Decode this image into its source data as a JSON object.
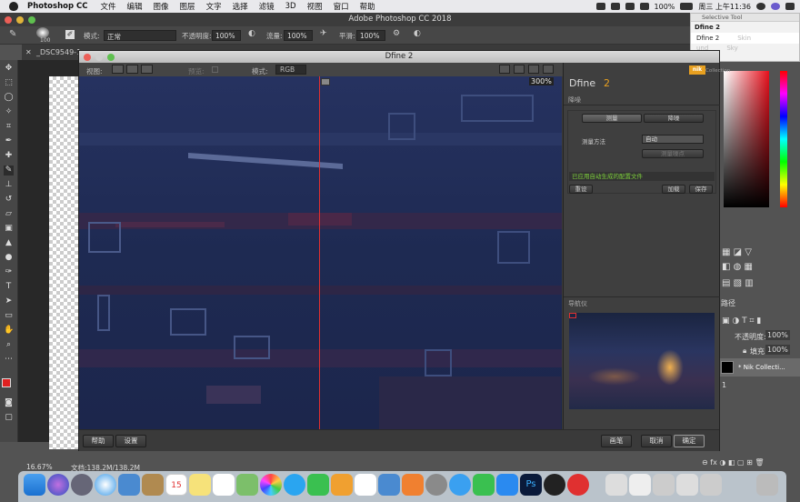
{
  "menubar": {
    "app_name": "Photoshop CC",
    "items": [
      "文件",
      "编辑",
      "图像",
      "图层",
      "文字",
      "选择",
      "滤镜",
      "3D",
      "视图",
      "窗口",
      "帮助"
    ],
    "battery": "100%",
    "datetime": "周三 上午11:36"
  },
  "ps_window": {
    "title": "Adobe Photoshop CC 2018"
  },
  "options": {
    "brush_size": "100",
    "mode_label": "模式:",
    "mode_value": "正常",
    "opacity_label": "不透明度:",
    "opacity_value": "100%",
    "flow_label": "流量:",
    "flow_value": "100%",
    "smooth_label": "平滑:",
    "smooth_value": "100%"
  },
  "doc_tab": {
    "label": "_DSC9549-1"
  },
  "status": {
    "zoom": "16.67%",
    "doc": "文档:138.2M/138.2M"
  },
  "selective_tool": {
    "title": "Selective Tool",
    "header": "Dfine 2",
    "row_name": "Dfine 2",
    "row_type": "Skin",
    "row2_name": "und",
    "row2_type": "Sky"
  },
  "dfine": {
    "title": "Dfine 2",
    "view_label": "视图:",
    "preview_label": "预览:",
    "mode_label": "模式:",
    "mode_value": "RGB",
    "zoom": "300%",
    "brand_name": "Dfine",
    "brand_version": "2",
    "brand_logo": "nik",
    "brand_collection": "Collection",
    "section_noise": "降噪",
    "tab_measure": "测量",
    "tab_reduce": "降噪",
    "method_label": "测量方法",
    "method_value": "自动",
    "measure_noise_btn": "测量噪点",
    "status_msg": "已应用自动生成的配置文件",
    "reset_btn": "重设",
    "load_btn": "加载",
    "save_btn": "保存",
    "navigator": "导航仪",
    "help_btn": "帮助",
    "settings_btn": "设置",
    "brush_btn": "画笔",
    "cancel_btn": "取消",
    "ok_btn": "确定"
  },
  "layers": {
    "paths_tab": "路径",
    "opacity_label": "不透明度:",
    "opacity_value": "100%",
    "fill_label": "填充:",
    "fill_value": "100%",
    "layer_name": "* Nik Collecti...",
    "layer2_name": "1"
  },
  "colors": {
    "accent_red": "#e02020",
    "image_blue": "#1f2c55"
  }
}
